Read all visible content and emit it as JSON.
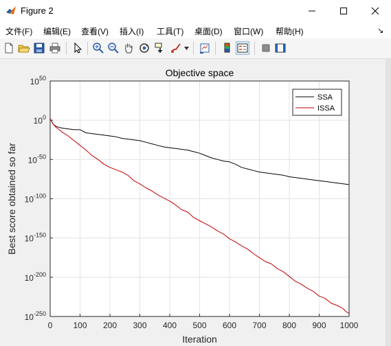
{
  "window": {
    "title": "Figure 2"
  },
  "menu": {
    "items": [
      {
        "label": "文件(F)"
      },
      {
        "label": "编辑(E)"
      },
      {
        "label": "查看(V)"
      },
      {
        "label": "插入(I)"
      },
      {
        "label": "工具(T)"
      },
      {
        "label": "桌面(D)"
      },
      {
        "label": "窗口(W)"
      },
      {
        "label": "帮助(H)"
      }
    ]
  },
  "toolbar": {
    "icons": [
      "new-figure-icon",
      "open-file-icon",
      "save-icon",
      "print-icon",
      "edit-plot-arrow-icon",
      "zoom-in-icon",
      "zoom-out-icon",
      "pan-hand-icon",
      "rotate-3d-icon",
      "data-cursor-icon",
      "brush-icon",
      "link-plot-icon",
      "insert-colorbar-icon",
      "insert-legend-icon",
      "hide-plot-tools-icon",
      "show-plot-tools-icon"
    ]
  },
  "chart_data": {
    "type": "line",
    "title": "Objective space",
    "xlabel": "Iteration",
    "ylabel": "Best score obtained so far",
    "xlim": [
      0,
      1000
    ],
    "ylim_log10": [
      -250,
      50
    ],
    "yscale": "log",
    "grid": true,
    "legend_position": "top-right",
    "x_ticks": [
      "0",
      "100",
      "200",
      "300",
      "400",
      "500",
      "600",
      "700",
      "800",
      "900",
      "1000"
    ],
    "y_ticks": [
      {
        "base": "10",
        "exp": "50"
      },
      {
        "base": "10",
        "exp": "0"
      },
      {
        "base": "10",
        "exp": "-50"
      },
      {
        "base": "10",
        "exp": "-100"
      },
      {
        "base": "10",
        "exp": "-150"
      },
      {
        "base": "10",
        "exp": "-200"
      },
      {
        "base": "10",
        "exp": "-250"
      }
    ],
    "series": [
      {
        "name": "SSA",
        "color": "#000000",
        "x": [
          0,
          10,
          20,
          40,
          60,
          80,
          100,
          110,
          120,
          140,
          160,
          180,
          200,
          220,
          240,
          260,
          280,
          300,
          320,
          340,
          360,
          380,
          400,
          420,
          440,
          460,
          480,
          500,
          520,
          540,
          560,
          580,
          600,
          620,
          640,
          660,
          680,
          700,
          720,
          740,
          760,
          780,
          800,
          820,
          840,
          860,
          880,
          900,
          920,
          940,
          960,
          980,
          1000
        ],
        "log10_y": [
          2,
          -5,
          -8,
          -10,
          -11,
          -12,
          -12,
          -14,
          -16,
          -17,
          -18,
          -19,
          -20,
          -21,
          -23,
          -24,
          -25,
          -26,
          -28,
          -30,
          -32,
          -34,
          -35,
          -36,
          -37,
          -38,
          -40,
          -42,
          -45,
          -48,
          -50,
          -52,
          -53,
          -56,
          -60,
          -62,
          -64,
          -66,
          -67,
          -68,
          -69,
          -70,
          -72,
          -73,
          -74,
          -75,
          -76,
          -77,
          -78,
          -79,
          -80,
          -81,
          -82
        ]
      },
      {
        "name": "ISSA",
        "color": "#c00000",
        "x": [
          0,
          10,
          20,
          40,
          60,
          80,
          100,
          120,
          140,
          160,
          180,
          200,
          220,
          240,
          260,
          280,
          300,
          320,
          340,
          360,
          380,
          400,
          420,
          440,
          460,
          480,
          500,
          520,
          540,
          560,
          580,
          600,
          620,
          640,
          660,
          680,
          700,
          720,
          740,
          760,
          780,
          800,
          820,
          840,
          860,
          880,
          900,
          920,
          940,
          960,
          980,
          990,
          1000
        ],
        "log10_y": [
          2,
          -5,
          -9,
          -15,
          -20,
          -26,
          -32,
          -38,
          -45,
          -50,
          -56,
          -60,
          -63,
          -66,
          -70,
          -77,
          -81,
          -86,
          -90,
          -95,
          -99,
          -103,
          -108,
          -114,
          -117,
          -124,
          -128,
          -132,
          -136,
          -141,
          -145,
          -151,
          -155,
          -160,
          -164,
          -170,
          -175,
          -180,
          -183,
          -189,
          -193,
          -199,
          -205,
          -209,
          -214,
          -218,
          -224,
          -227,
          -233,
          -236,
          -240,
          -244,
          -246
        ]
      }
    ]
  }
}
